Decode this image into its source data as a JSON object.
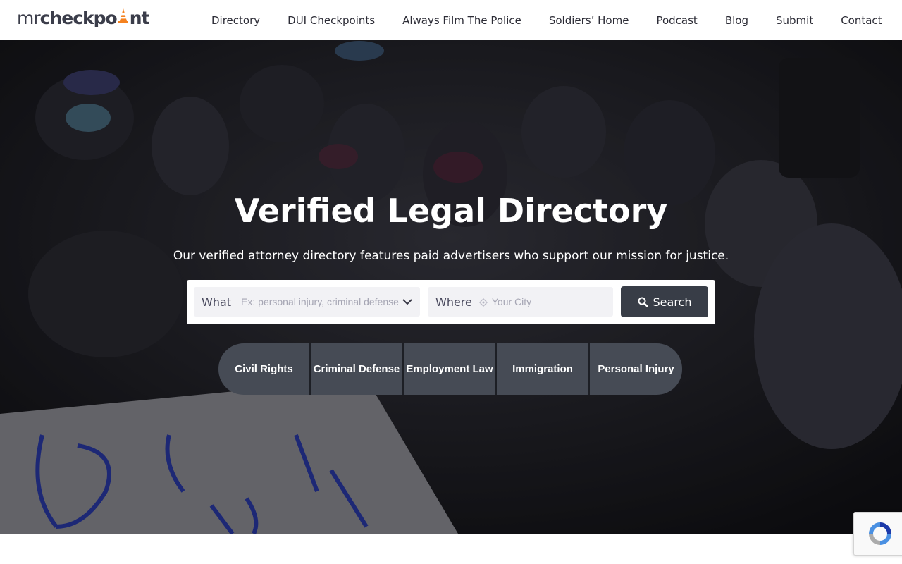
{
  "brand": {
    "prefix": "mr",
    "name_a": "checkpo",
    "name_b": "nt"
  },
  "nav": [
    {
      "label": "Directory"
    },
    {
      "label": "DUI Checkpoints"
    },
    {
      "label": "Always Film The Police"
    },
    {
      "label": "Soldiers’ Home"
    },
    {
      "label": "Podcast"
    },
    {
      "label": "Blog"
    },
    {
      "label": "Submit"
    },
    {
      "label": "Contact"
    }
  ],
  "hero": {
    "title": "Verified Legal Directory",
    "subtitle": "Our verified attorney directory features paid advertisers who support our mission for justice."
  },
  "search": {
    "what_label": "What",
    "what_placeholder": "Ex: personal injury, criminal defense",
    "where_label": "Where",
    "where_placeholder": "Your City",
    "button_label": "Search"
  },
  "categories": [
    {
      "label": "Civil Rights"
    },
    {
      "label": "Criminal Defense"
    },
    {
      "label": "Employment Law"
    },
    {
      "label": "Immigration"
    },
    {
      "label": "Personal Injury"
    }
  ],
  "colors": {
    "accent_orange": "#f5821f",
    "button_dark": "#383d47",
    "category_bg": "#464b55"
  },
  "icons": {
    "logo_cone": "traffic-cone-icon",
    "search": "search-icon",
    "dropdown": "chevron-down-icon",
    "location": "location-pin-icon",
    "recaptcha": "recaptcha-icon"
  }
}
